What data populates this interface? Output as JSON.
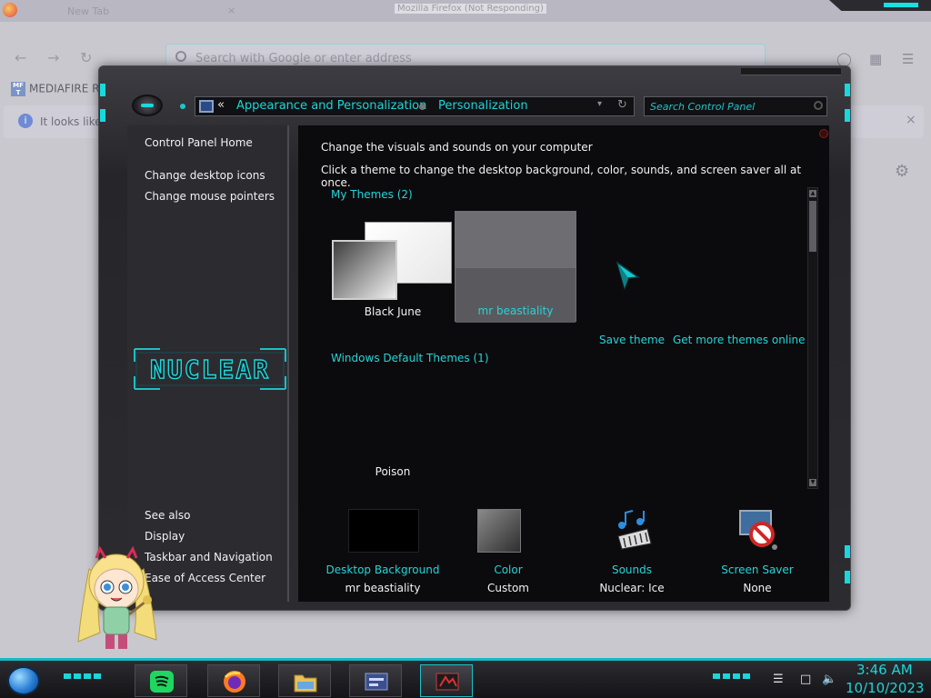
{
  "firefox": {
    "window_title": "Mozilla Firefox (Not Responding)",
    "tab_title": "New Tab",
    "tab_close": "×",
    "search_placeholder": "Search with Google or enter address",
    "bookmark_icon_text": "MF\nT",
    "bookmark_label": "MEDIAFIRE RO",
    "notice_text": "It looks like",
    "notice_close": "×",
    "icons": [
      "back-icon",
      "forward-icon",
      "reload-icon",
      "pocket-icon",
      "extensions-icon",
      "menu-icon",
      "settings-icon"
    ]
  },
  "control_panel": {
    "address": {
      "back_symbol": "«",
      "crumbs": [
        "Appearance and Personalization",
        "Personalization"
      ],
      "dropdown": "▾",
      "refresh": "↻"
    },
    "search_placeholder": "Search Control Panel",
    "nav": {
      "home": "Control Panel Home",
      "links": [
        "Change desktop icons",
        "Change mouse pointers"
      ],
      "see_also_heading": "See also",
      "see_also": [
        "Display",
        "Taskbar and Navigation",
        "Ease of Access Center"
      ]
    },
    "logo_text": "NUCLEAR",
    "content": {
      "heading": "Change the visuals and sounds on your computer",
      "subheading": "Click a theme to change the desktop background, color, sounds, and screen saver all at once.",
      "my_themes_heading": "My Themes (2)",
      "my_themes": [
        {
          "name": "Black June",
          "selected": false
        },
        {
          "name": "mr beastiality",
          "selected": true
        }
      ],
      "save_theme": "Save theme",
      "get_more": "Get more themes online",
      "default_themes_heading": "Windows Default Themes (1)",
      "default_themes": [
        {
          "name": "Poison"
        }
      ]
    },
    "settings": [
      {
        "title": "Desktop Background",
        "value": "mr beastiality",
        "icon": "desktop-background-swatch"
      },
      {
        "title": "Color",
        "value": "Custom",
        "icon": "color-swatch"
      },
      {
        "title": "Sounds",
        "value": "Nuclear: Ice",
        "icon": "sounds-icon"
      },
      {
        "title": "Screen Saver",
        "value": "None",
        "icon": "screen-saver-icon"
      }
    ]
  },
  "taskbar": {
    "apps": [
      "spotify",
      "firefox",
      "file-explorer",
      "control-panel",
      "personalization"
    ],
    "time": "3:46 AM",
    "date": "10/10/2023"
  },
  "colors": {
    "accent_cyan": "#1fd3d6",
    "window_dark": "#0b0b0d",
    "nav_pane": "#2b2b30"
  }
}
